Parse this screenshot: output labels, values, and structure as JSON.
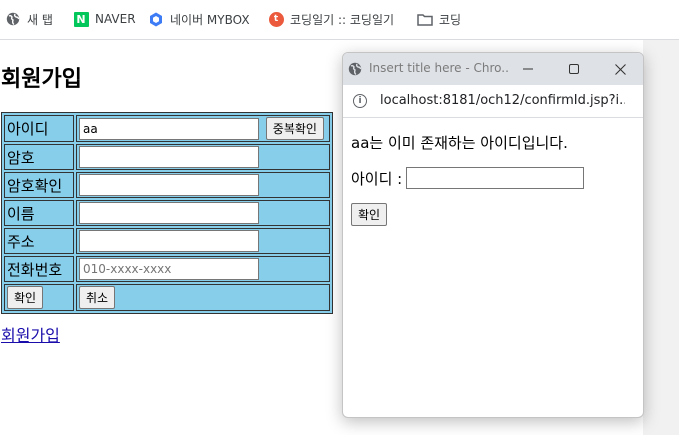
{
  "bookmarks": [
    {
      "label": "새 탭",
      "icon": "globe-icon"
    },
    {
      "label": "NAVER",
      "icon": "naver-icon"
    },
    {
      "label": "네이버 MYBOX",
      "icon": "mybox-icon"
    },
    {
      "label": "코딩일기 :: 코딩일기",
      "icon": "tistory-icon"
    },
    {
      "label": "코딩",
      "icon": "folder-icon"
    }
  ],
  "page": {
    "title": "회원가입",
    "rows": [
      {
        "label": "아이디",
        "value": "aa",
        "button": "중복확인"
      },
      {
        "label": "암호",
        "value": ""
      },
      {
        "label": "암호확인",
        "value": ""
      },
      {
        "label": "이름",
        "value": ""
      },
      {
        "label": "주소",
        "value": ""
      },
      {
        "label": "전화번호",
        "value": "",
        "placeholder": "010-xxxx-xxxx"
      }
    ],
    "submit_label": "확인",
    "reset_label": "취소",
    "link_text": "회원가입",
    "table_bg": "#87ceeb"
  },
  "popup": {
    "title": "Insert title here - Chro...",
    "url": "localhost:8181/och12/confirmId.jsp?i...",
    "message": "aa는 이미 존재하는 아이디입니다.",
    "id_label": "아이디 :",
    "id_value": "",
    "ok_label": "확인"
  }
}
